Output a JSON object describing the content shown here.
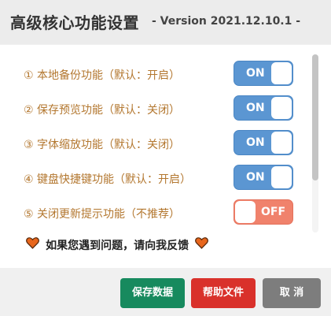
{
  "header": {
    "title": "高级核心功能设置",
    "version": "- Version 2021.12.10.1 -"
  },
  "settings": [
    {
      "label": "① 本地备份功能（默认：开启）",
      "state": "ON"
    },
    {
      "label": "② 保存预览功能（默认：关闭）",
      "state": "ON"
    },
    {
      "label": "③ 字体缩放功能（默认：关闭）",
      "state": "ON"
    },
    {
      "label": "④ 键盘快捷键功能（默认：开启）",
      "state": "ON"
    },
    {
      "label": "⑤ 关闭更新提示功能（不推荐）",
      "state": "OFF"
    }
  ],
  "feedback": {
    "text": "如果您遇到问题，请向我反馈",
    "icon": "heart-icon",
    "icon_color": "#e8661c"
  },
  "buttons": {
    "save": "保存数据",
    "help": "帮助文件",
    "cancel": "取 消"
  },
  "colors": {
    "label": "#b3772f",
    "toggle_on": "#5b96d2",
    "toggle_off": "#f0826c",
    "save": "#178a5e",
    "help": "#d9312b",
    "cancel": "#7d7d7d"
  }
}
